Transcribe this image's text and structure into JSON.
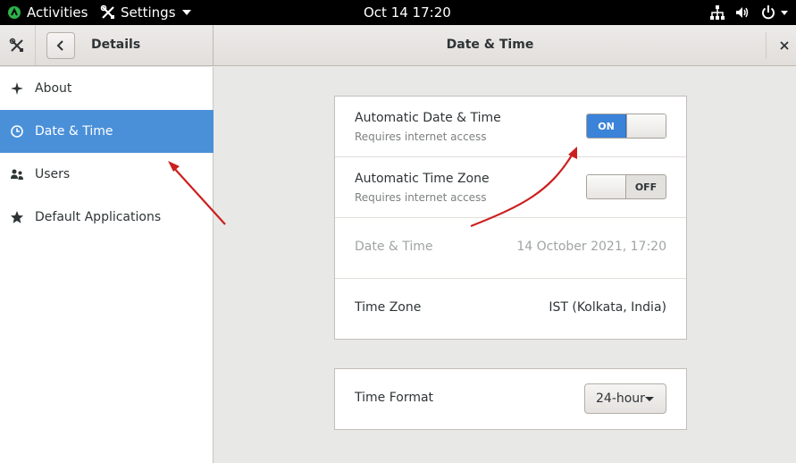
{
  "topbar": {
    "activities": "Activities",
    "app_menu": "Settings",
    "clock": "Oct 14  17:20"
  },
  "header": {
    "sidebar_title": "Details",
    "main_title": "Date & Time"
  },
  "sidebar": {
    "items": [
      {
        "label": "About",
        "icon": "star-sparkle-icon"
      },
      {
        "label": "Date & Time",
        "icon": "clock-icon",
        "active": true
      },
      {
        "label": "Users",
        "icon": "users-icon"
      },
      {
        "label": "Default Applications",
        "icon": "star-icon"
      }
    ]
  },
  "datetime": {
    "auto_date_title": "Automatic Date & Time",
    "auto_date_sub": "Requires internet access",
    "auto_date_switch": "ON",
    "auto_tz_title": "Automatic Time Zone",
    "auto_tz_sub": "Requires internet access",
    "auto_tz_switch": "OFF",
    "date_time_label": "Date & Time",
    "date_time_value": "14 October 2021, 17:20",
    "timezone_label": "Time Zone",
    "timezone_value": "IST (Kolkata, India)"
  },
  "format": {
    "label": "Time Format",
    "selected": "24-hour"
  },
  "colors": {
    "accent": "#4a90d9",
    "annotation_arrow": "#cc1f1f"
  }
}
